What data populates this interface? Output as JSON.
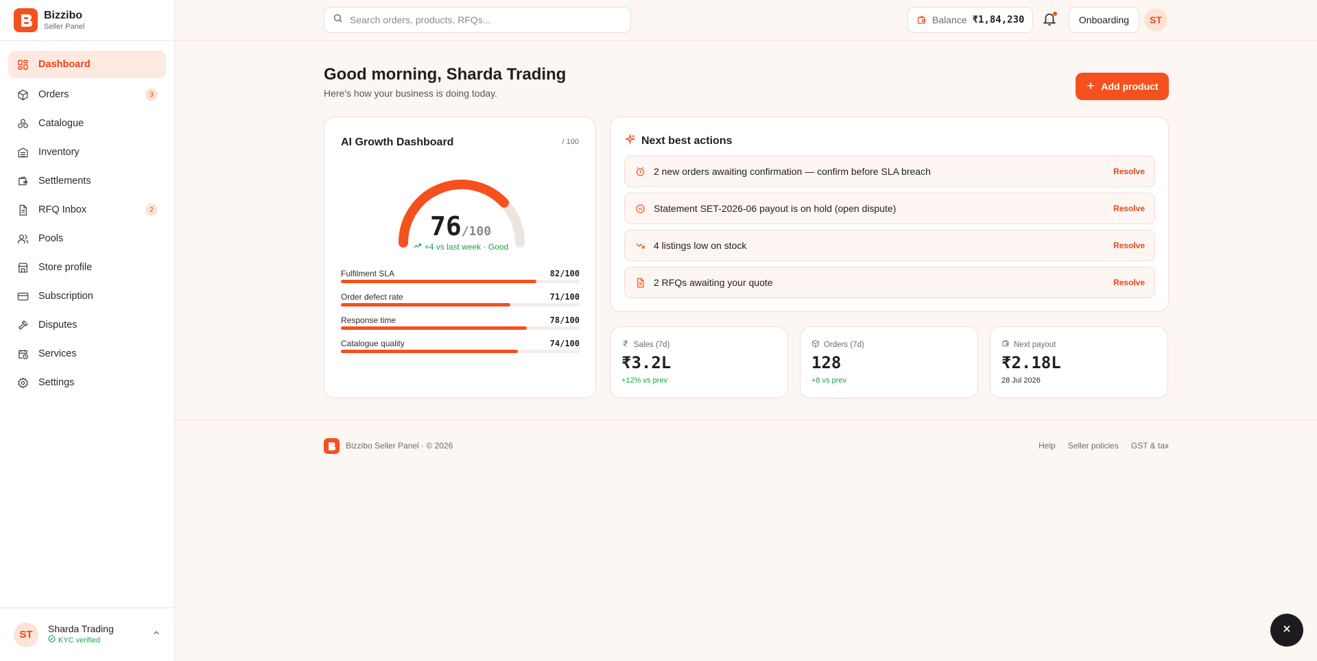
{
  "brand": {
    "name": "Bizzibo",
    "subtitle": "Seller Panel"
  },
  "sidebar": {
    "items": [
      {
        "label": "Dashboard",
        "icon": "grid-icon",
        "active": true
      },
      {
        "label": "Orders",
        "icon": "package-icon",
        "badge": "3"
      },
      {
        "label": "Catalogue",
        "icon": "catalogue-icon"
      },
      {
        "label": "Inventory",
        "icon": "inventory-icon"
      },
      {
        "label": "Settlements",
        "icon": "wallet-icon"
      },
      {
        "label": "RFQ Inbox",
        "icon": "document-icon",
        "badge": "2"
      },
      {
        "label": "Pools",
        "icon": "users-icon"
      },
      {
        "label": "Store profile",
        "icon": "store-icon"
      },
      {
        "label": "Subscription",
        "icon": "card-icon"
      },
      {
        "label": "Disputes",
        "icon": "gavel-icon"
      },
      {
        "label": "Services",
        "icon": "calendar-clock-icon"
      },
      {
        "label": "Settings",
        "icon": "gear-icon"
      }
    ],
    "user": {
      "initials": "ST",
      "name": "Sharda Trading",
      "status": "KYC verified"
    }
  },
  "topbar": {
    "search_placeholder": "Search orders, products, RFQs...",
    "balance_label": "Balance",
    "balance_value": "₹1,84,230",
    "onboarding_label": "Onboarding",
    "avatar_initials": "ST"
  },
  "main": {
    "greeting": "Good morning, Sharda Trading",
    "subtitle": "Here's how your business is doing today.",
    "add_product_label": "Add product"
  },
  "growth": {
    "title": "AI Growth Dashboard",
    "out_of": "/ 100",
    "score": "76",
    "score_suffix": "/100",
    "score_fraction": 0.76,
    "trend": "+4 vs last week · Good",
    "metrics": [
      {
        "label": "Fulfilment SLA",
        "value": "82/100",
        "fraction": 0.82
      },
      {
        "label": "Order defect rate",
        "value": "71/100",
        "fraction": 0.71
      },
      {
        "label": "Response time",
        "value": "78/100",
        "fraction": 0.78
      },
      {
        "label": "Catalogue quality",
        "value": "74/100",
        "fraction": 0.74
      }
    ]
  },
  "actions": {
    "title": "Next best actions",
    "resolve_label": "Resolve",
    "items": [
      {
        "text": "2 new orders awaiting confirmation — confirm before SLA breach",
        "icon": "alarm-clock-icon"
      },
      {
        "text": "Statement SET-2026-06 payout is on hold (open dispute)",
        "icon": "pause-circle-icon"
      },
      {
        "text": "4 listings low on stock",
        "icon": "trending-down-icon"
      },
      {
        "text": "2 RFQs awaiting your quote",
        "icon": "file-text-icon"
      }
    ]
  },
  "stats": [
    {
      "label": "Sales (7d)",
      "value": "₹3.2L",
      "sub": "+12% vs prev",
      "icon": "rupee-icon"
    },
    {
      "label": "Orders (7d)",
      "value": "128",
      "sub": "+8 vs prev",
      "icon": "box-icon"
    },
    {
      "label": "Next payout",
      "value": "₹2.18L",
      "sub": "28 Jul 2026",
      "icon": "wallet-icon"
    }
  ],
  "footer": {
    "text": "Bizzibo Seller Panel · © 2026",
    "links": [
      "Help",
      "Seller policies",
      "GST & tax"
    ]
  },
  "colors": {
    "accent": "#f4511e",
    "positive": "#16a34a",
    "background": "#fdf7f3"
  }
}
